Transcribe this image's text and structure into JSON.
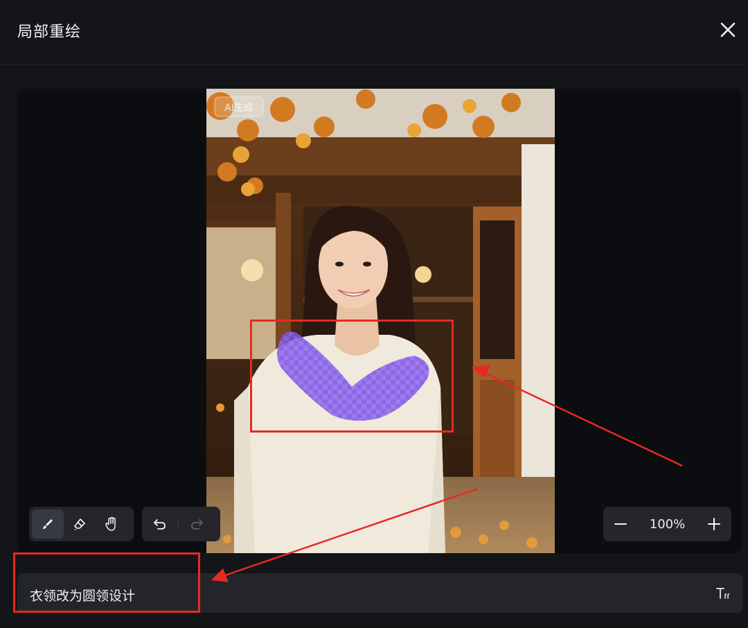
{
  "header": {
    "title": "局部重绘",
    "close_icon": "close-icon"
  },
  "canvas": {
    "image_watermark": "AI生成",
    "mask_color": "#8b5cf6"
  },
  "toolbar": {
    "brush_icon": "brush-icon",
    "eraser_icon": "eraser-icon",
    "hand_icon": "hand-icon",
    "undo_icon": "undo-icon",
    "redo_icon": "redo-icon",
    "zoom_out_icon": "minus-icon",
    "zoom_in_icon": "plus-icon",
    "zoom_level": "100%"
  },
  "prompt": {
    "value": "衣领改为圆领设计",
    "text_tool_icon": "text-format-icon"
  },
  "colors": {
    "background": "#141519",
    "panel": "#24262c",
    "annotation": "#e52a23"
  }
}
